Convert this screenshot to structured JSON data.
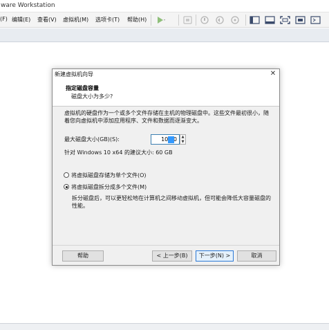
{
  "window": {
    "title": "ware Workstation"
  },
  "menu": [
    {
      "label": "(F)"
    },
    {
      "label": "编辑(E)"
    },
    {
      "label": "查看(V)"
    },
    {
      "label": "虚拟机(M)"
    },
    {
      "label": "选项卡(T)"
    },
    {
      "label": "帮助(H)"
    }
  ],
  "toolbar": [
    {
      "icon": "power-play-icon"
    },
    {
      "icon": "send-keys-icon"
    },
    {
      "icon": "snapshot-icon"
    },
    {
      "icon": "revert-snapshot-icon"
    },
    {
      "icon": "snapshot-manager-icon"
    },
    {
      "icon": "show-library-icon"
    },
    {
      "icon": "thumbnail-view-icon"
    },
    {
      "icon": "full-screen-icon"
    },
    {
      "icon": "unity-icon"
    },
    {
      "icon": "console-view-icon"
    }
  ],
  "dialog": {
    "title": "新建虚拟机向导",
    "close_glyph": "✕",
    "header_title": "指定磁盘容量",
    "header_subtitle": "磁盘大小为多少?",
    "description": "虚拟机的硬盘作为一个或多个文件存储在主机的物理磁盘中。这些文件最初很小，随着您向虚拟机中添加应用程序、文件和数据而逐渐变大。",
    "disk_size_label": "最大磁盘大小(GB)(S):",
    "disk_size_value": "100.0",
    "recommendation": "针对 Windows 10 x64 的建议大小: 60 GB",
    "option_single": "将虚拟磁盘存储为单个文件(O)",
    "option_split": "将虚拟磁盘拆分成多个文件(M)",
    "selected_option": "split",
    "split_description": "拆分磁盘后，可以更轻松地在计算机之间移动虚拟机，但可能会降低大容量磁盘的性能。",
    "buttons": {
      "help": "帮助",
      "back": "< 上一步(B)",
      "next": "下一步(N) >",
      "cancel": "取消"
    }
  }
}
